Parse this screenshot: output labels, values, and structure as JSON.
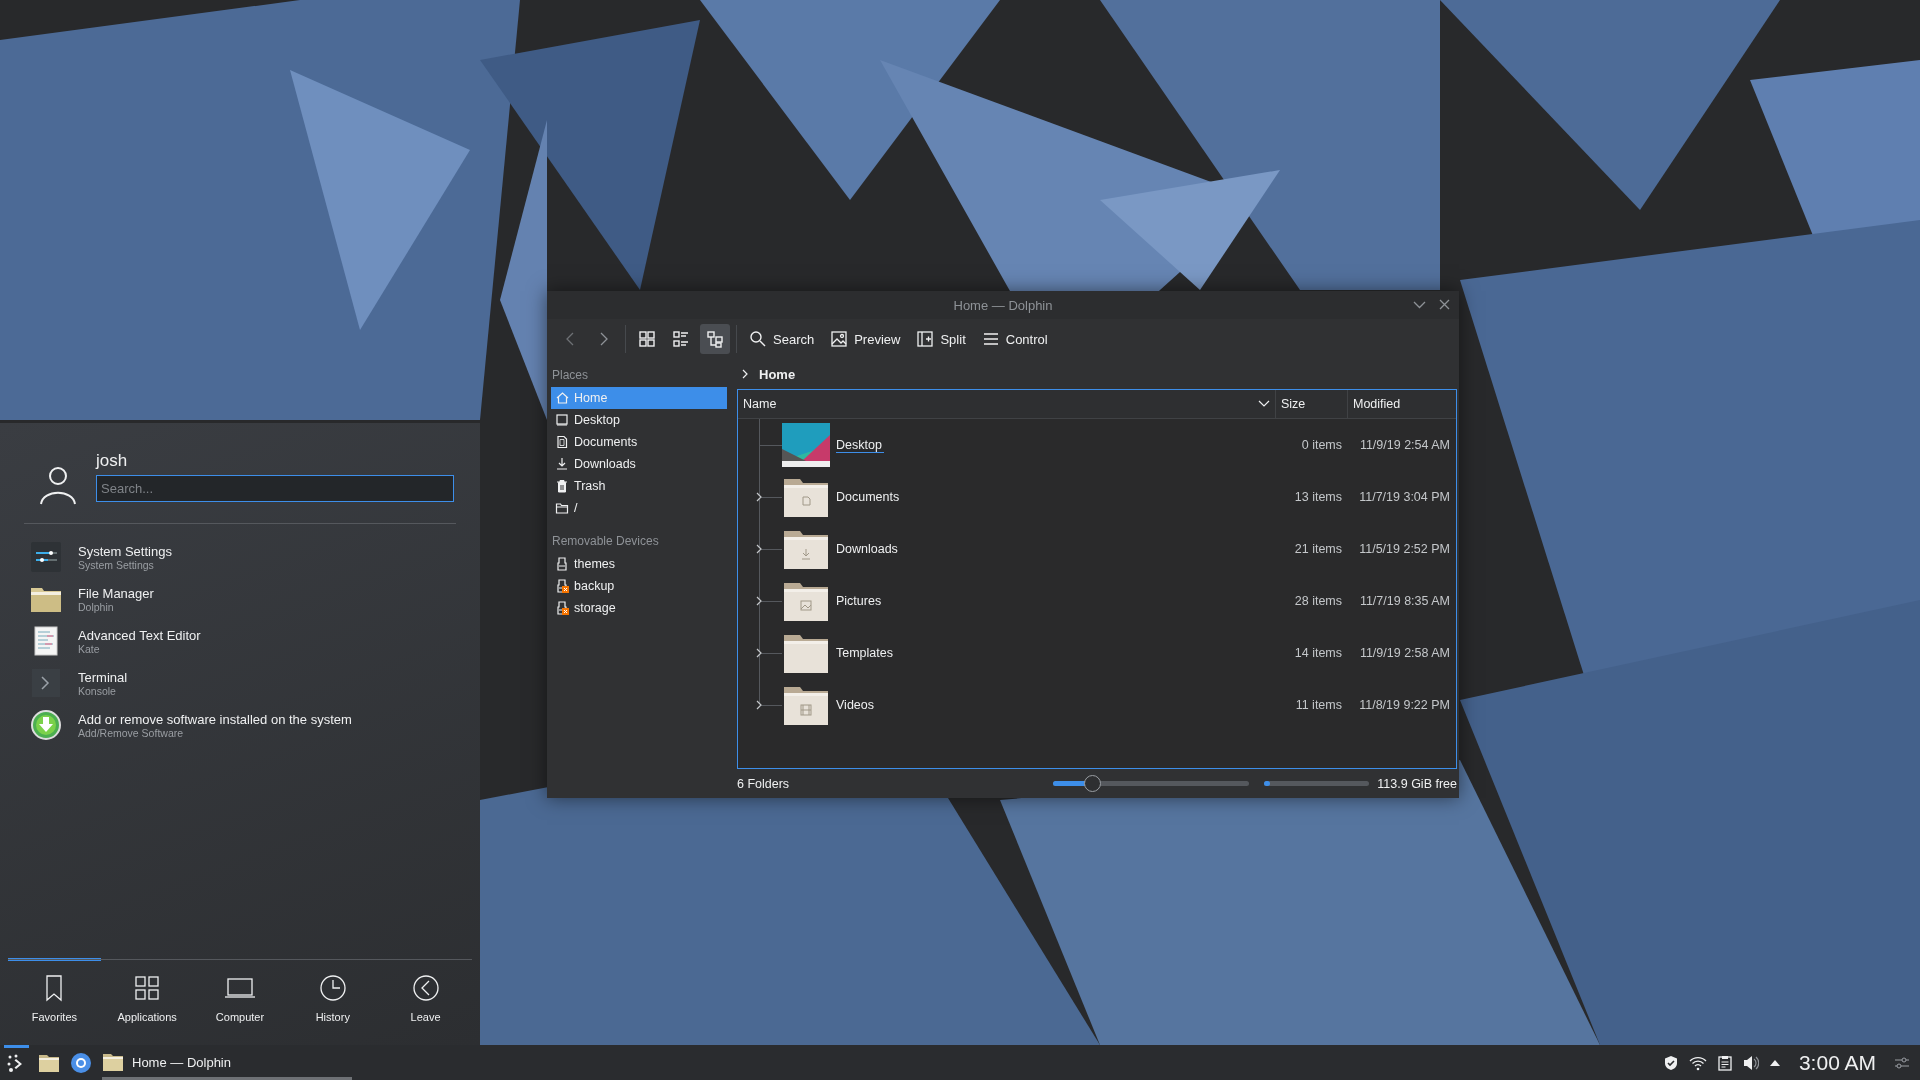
{
  "launcher": {
    "user": "josh",
    "search": {
      "placeholder": "Search..."
    },
    "favorites": [
      {
        "title": "System Settings",
        "subtitle": "System Settings"
      },
      {
        "title": "File Manager",
        "subtitle": "Dolphin"
      },
      {
        "title": "Advanced Text Editor",
        "subtitle": "Kate"
      },
      {
        "title": "Terminal",
        "subtitle": "Konsole"
      },
      {
        "title": "Add or remove software installed on the system",
        "subtitle": "Add/Remove Software"
      }
    ],
    "tabs": [
      {
        "label": "Favorites",
        "selected": true
      },
      {
        "label": "Applications",
        "selected": false
      },
      {
        "label": "Computer",
        "selected": false
      },
      {
        "label": "History",
        "selected": false
      },
      {
        "label": "Leave",
        "selected": false
      }
    ]
  },
  "dolphin": {
    "title": "Home — Dolphin",
    "view_modes": [
      {
        "selected": false
      },
      {
        "selected": false
      },
      {
        "selected": true
      }
    ],
    "actions": [
      "Search",
      "Preview",
      "Split",
      "Control"
    ],
    "places": [
      {
        "heading": "Places",
        "items": [
          {
            "label": "Home",
            "selected": true
          },
          {
            "label": "Desktop",
            "selected": false
          },
          {
            "label": "Documents",
            "selected": false
          },
          {
            "label": "Downloads",
            "selected": false
          },
          {
            "label": "Trash",
            "selected": false
          },
          {
            "label": "/",
            "selected": false
          }
        ]
      },
      {
        "heading": "Removable Devices",
        "items": [
          {
            "label": "themes",
            "selected": false,
            "mounted": true
          },
          {
            "label": "backup",
            "selected": false,
            "mounted": false
          },
          {
            "label": "storage",
            "selected": false,
            "mounted": false
          }
        ]
      }
    ],
    "breadcrumb": "Home",
    "columns": [
      "Name",
      "Size",
      "Modified"
    ],
    "files": [
      {
        "name": "Desktop",
        "size": "0 items",
        "modified": "11/9/19 2:54 AM",
        "expandable": false,
        "hovered": true
      },
      {
        "name": "Documents",
        "size": "13 items",
        "modified": "11/7/19 3:04 PM",
        "expandable": true,
        "hovered": false
      },
      {
        "name": "Downloads",
        "size": "21 items",
        "modified": "11/5/19 2:52 PM",
        "expandable": true,
        "hovered": false
      },
      {
        "name": "Pictures",
        "size": "28 items",
        "modified": "11/7/19 8:35 AM",
        "expandable": true,
        "hovered": false
      },
      {
        "name": "Templates",
        "size": "14 items",
        "modified": "11/9/19 2:58 AM",
        "expandable": true,
        "hovered": false
      },
      {
        "name": "Videos",
        "size": "11 items",
        "modified": "11/8/19 9:22 PM",
        "expandable": true,
        "hovered": false
      }
    ],
    "status": {
      "summary": "6 Folders",
      "zoom": {
        "level": 0.2
      },
      "free_space": {
        "level": 0.05
      },
      "free_text": "113.9 GiB free"
    }
  },
  "taskbar": {
    "launcher_open": true,
    "tasks": [
      {
        "label": "Home — Dolphin"
      }
    ],
    "clock": "3:00 AM"
  }
}
